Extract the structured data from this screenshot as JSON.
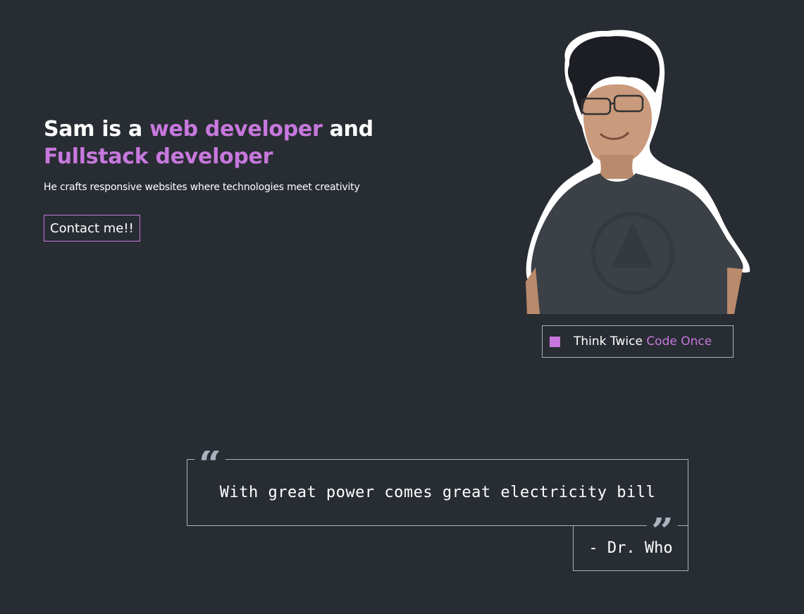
{
  "hero": {
    "title_part1": "Sam is a ",
    "title_accent1": "web developer",
    "title_part2": " and ",
    "title_accent2": "Fullstack developer",
    "subtitle": "He crafts responsive websites where technologies meet creativity",
    "contact_label": "Contact me!!"
  },
  "status": {
    "text_plain": "Think Twice ",
    "text_accent": "Code Once"
  },
  "quote": {
    "open_mark": "“",
    "text": "With great power comes great electricity bill",
    "close_mark": "”",
    "author": "- Dr. Who"
  },
  "colors": {
    "background": "#282c33",
    "accent": "#c778dd",
    "border": "#abb2bf",
    "text": "#ffffff"
  },
  "icons": {
    "status_square": "square-icon",
    "quote_open": "quote-open-icon",
    "quote_close": "quote-close-icon"
  }
}
